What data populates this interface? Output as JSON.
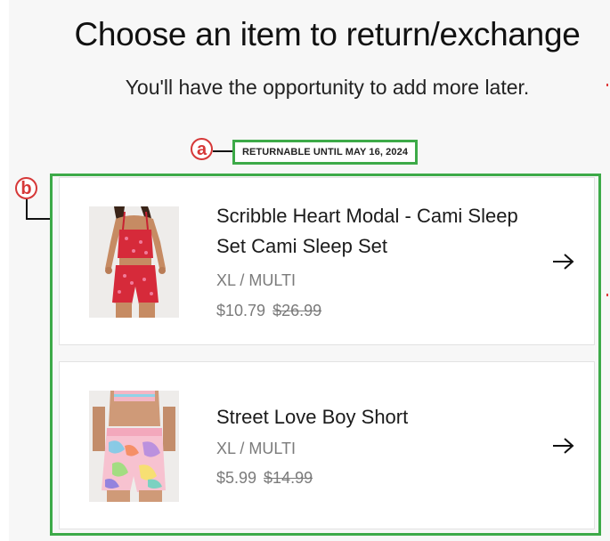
{
  "header": {
    "title": "Choose an item to return/exchange",
    "subtitle": "You'll have the opportunity to add more later."
  },
  "annotations": {
    "a": "a",
    "b": "b"
  },
  "returnable_label": "RETURNABLE UNTIL MAY 16, 2024",
  "items": [
    {
      "name": "Scribble Heart Modal - Cami Sleep Set Cami Sleep Set",
      "variant": "XL / MULTI",
      "price": "$10.79",
      "original_price": "$26.99",
      "icon": "arrow-right-icon"
    },
    {
      "name": "Street Love Boy Short",
      "variant": "XL / MULTI",
      "price": "$5.99",
      "original_price": "$14.99",
      "icon": "arrow-right-icon"
    }
  ],
  "colors": {
    "annotation_red": "#d63838",
    "highlight_green": "#3daa48",
    "muted_text": "#7b7b7b"
  }
}
